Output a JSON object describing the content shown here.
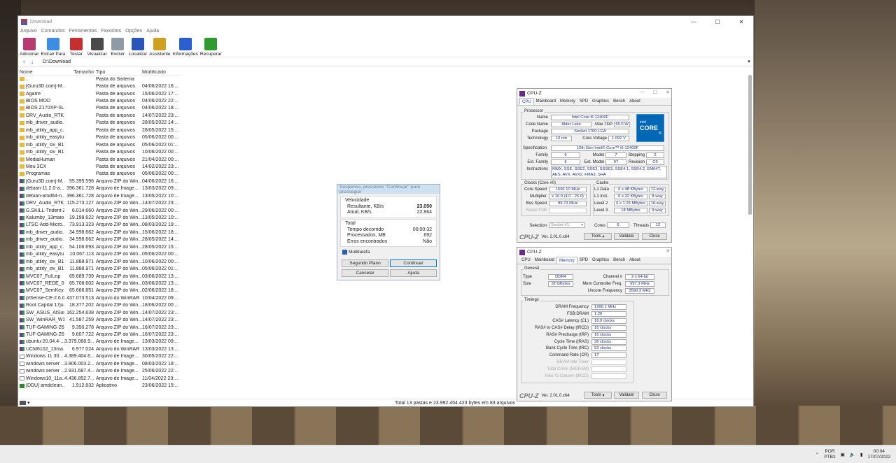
{
  "winrar": {
    "title": "Download",
    "menu": [
      "Arquivo",
      "Comandos",
      "Ferramentas",
      "Favoritos",
      "Opções",
      "Ajuda"
    ],
    "toolbar": [
      {
        "label": "Adicionar",
        "icon": "add-archive-icon",
        "color": "#b83a70"
      },
      {
        "label": "Extrair Para",
        "icon": "extract-folder-icon",
        "color": "#3d8ee0"
      },
      {
        "label": "Testar",
        "icon": "test-checklist-icon",
        "color": "#c43030"
      },
      {
        "label": "Visualizar",
        "icon": "view-book-icon",
        "color": "#4a4a4a"
      },
      {
        "label": "Excluir",
        "icon": "delete-bin-icon",
        "color": "#8e9aa6"
      },
      {
        "label": "Localizar",
        "icon": "find-magnifier-icon",
        "color": "#2a56b8"
      },
      {
        "label": "Assistente",
        "icon": "wizard-wand-icon",
        "color": "#d0a020"
      },
      {
        "label": "Informações",
        "icon": "info-icon",
        "color": "#2a5fd0"
      },
      {
        "label": "Recuperar",
        "icon": "repair-first-aid-icon",
        "color": "#2f9a2f"
      }
    ],
    "path": "D:\\Download",
    "columns": [
      "Nome",
      "Tamanho",
      "Tipo",
      "Modificado"
    ],
    "files": [
      {
        "n": "..",
        "s": "",
        "t": "Pasta do Sistema",
        "m": "",
        "k": "folder"
      },
      {
        "n": "[Guru3D.com]-M...",
        "s": "",
        "t": "Pasta de arquivos",
        "m": "04/06/2022 16:...",
        "k": "folder"
      },
      {
        "n": "Agarre",
        "s": "",
        "t": "Pasta de arquivos",
        "m": "15/06/2022 17:...",
        "k": "folder"
      },
      {
        "n": "BIOS MOD",
        "s": "",
        "t": "Pasta de arquivos",
        "m": "04/06/2022 22:...",
        "k": "folder"
      },
      {
        "n": "BIOS Z170XP-SLI",
        "s": "",
        "t": "Pasta de arquivos",
        "m": "04/06/2022 18:...",
        "k": "folder"
      },
      {
        "n": "DRV_Audio_RTK_...",
        "s": "",
        "t": "Pasta de arquivos",
        "m": "14/07/2022 23:...",
        "k": "folder"
      },
      {
        "n": "mb_driver_audio...",
        "s": "",
        "t": "Pasta de arquivos",
        "m": "28/05/2022 14:...",
        "k": "folder"
      },
      {
        "n": "mb_utility_app_c...",
        "s": "",
        "t": "Pasta de arquivos",
        "m": "28/05/2022 15:...",
        "k": "folder"
      },
      {
        "n": "mb_utility_easytu...",
        "s": "",
        "t": "Pasta de arquivos",
        "m": "05/06/2022 00:...",
        "k": "folder"
      },
      {
        "n": "mb_utility_siv_B1...",
        "s": "",
        "t": "Pasta de arquivos",
        "m": "05/06/2022 01:...",
        "k": "folder"
      },
      {
        "n": "mb_utility_siv_B1...",
        "s": "",
        "t": "Pasta de arquivos",
        "m": "10/06/2022 00:...",
        "k": "folder"
      },
      {
        "n": "MediaHuman",
        "s": "",
        "t": "Pasta de arquivos",
        "m": "21/04/2022 00:...",
        "k": "folder"
      },
      {
        "n": "Meu 3CX",
        "s": "",
        "t": "Pasta de arquivos",
        "m": "14/02/2022 23:...",
        "k": "folder"
      },
      {
        "n": "Programas",
        "s": "",
        "t": "Pasta de arquivos",
        "m": "05/06/2022 00:...",
        "k": "folder"
      },
      {
        "n": "[Guru3D.com]-M...",
        "s": "55.395.596",
        "t": "Arquivo ZIP do Win...",
        "m": "04/06/2022 16:...",
        "k": "arch"
      },
      {
        "n": "debian-11.2.0-a...",
        "s": "396.361.728",
        "t": "Arquivo de Image...",
        "m": "13/03/2022 09:...",
        "k": "arch"
      },
      {
        "n": "debian-amd64-n...",
        "s": "396.361.728",
        "t": "Arquivo de Image...",
        "m": "13/05/2022 10:...",
        "k": "arch"
      },
      {
        "n": "DRV_Audio_RTK_...",
        "s": "115.273.127",
        "t": "Arquivo ZIP do Win...",
        "m": "14/07/2022 23:...",
        "k": "arch"
      },
      {
        "n": "G.SKILL-Trident-Z...",
        "s": "6.014.660",
        "t": "Arquivo ZIP do Win...",
        "m": "29/06/2022 00:...",
        "k": "arch"
      },
      {
        "n": "Kalumby_13maio...",
        "s": "19.198.622",
        "t": "Arquivo ZIP do Win...",
        "m": "13/05/2022 10:...",
        "k": "arch"
      },
      {
        "n": "LTSC-Add-Micro...",
        "s": "73.913.323",
        "t": "Arquivo ZIP do Win...",
        "m": "08/03/2022 19:...",
        "k": "arch"
      },
      {
        "n": "mb_driver_audio...",
        "s": "34.998.662",
        "t": "Arquivo ZIP do Win...",
        "m": "15/06/2022 18:...",
        "k": "arch"
      },
      {
        "n": "mb_driver_audio...",
        "s": "34.998.662",
        "t": "Arquivo ZIP do Win...",
        "m": "28/05/2022 14:...",
        "k": "arch"
      },
      {
        "n": "mb_utility_app_c...",
        "s": "54.106.693",
        "t": "Arquivo ZIP do Win...",
        "m": "28/05/2022 15:...",
        "k": "arch"
      },
      {
        "n": "mb_utility_easytu...",
        "s": "10.067.113",
        "t": "Arquivo ZIP do Win...",
        "m": "05/06/2022 00:...",
        "k": "arch"
      },
      {
        "n": "mb_utility_siv_B1...",
        "s": "11.888.971",
        "t": "Arquivo ZIP do Win...",
        "m": "10/06/2022 00:...",
        "k": "arch"
      },
      {
        "n": "mb_utility_siv_B1...",
        "s": "11.888.971",
        "t": "Arquivo ZIP do Win...",
        "m": "05/06/2022 01:...",
        "k": "arch"
      },
      {
        "n": "MVC07_Full.zip",
        "s": "65.689.739",
        "t": "Arquivo ZIP do Win...",
        "m": "03/06/2022 13:...",
        "k": "arch"
      },
      {
        "n": "MVC07_REDE_03...",
        "s": "65.708.602",
        "t": "Arquivo ZIP do Win...",
        "m": "03/06/2022 13:...",
        "k": "arch"
      },
      {
        "n": "MVC07_SemKey...",
        "s": "65.666.851",
        "t": "Arquivo ZIP do Win...",
        "m": "02/06/2022 18:...",
        "k": "arch"
      },
      {
        "n": "pfSense-CE-2.6.0...",
        "s": "437.073.513",
        "t": "Arquivo do WinRAR",
        "m": "10/04/2022 09:...",
        "k": "arch"
      },
      {
        "n": "Root Capital 17ju...",
        "s": "18.377.202",
        "t": "Arquivo ZIP do Win...",
        "m": "18/06/2022 00:...",
        "k": "arch"
      },
      {
        "n": "SW_ASUS_AISuit...",
        "s": "162.254.638",
        "t": "Arquivo ZIP do Win...",
        "m": "14/07/2022 23:...",
        "k": "arch"
      },
      {
        "n": "SW_WinRAR_W1...",
        "s": "41.587.259",
        "t": "Arquivo ZIP do Win...",
        "m": "14/07/2022 23:...",
        "k": "arch"
      },
      {
        "n": "TUF-GAMING-Z6...",
        "s": "9.350.278",
        "t": "Arquivo ZIP do Win...",
        "m": "16/07/2022 23:...",
        "k": "arch"
      },
      {
        "n": "TUF-GAMING-Z6...",
        "s": "9.607.722",
        "t": "Arquivo ZIP do Win...",
        "m": "16/07/2022 23:...",
        "k": "arch"
      },
      {
        "n": "ubuntu-20.04.4-...",
        "s": "3.379.068.9...",
        "t": "Arquivo de Image...",
        "m": "13/03/2022 09:...",
        "k": "arch"
      },
      {
        "n": "UCM6102_13ma...",
        "s": "6.977.024",
        "t": "Arquivo do WinRAR",
        "m": "13/03/2022 13:...",
        "k": "arch"
      },
      {
        "n": "Windows 11 30...",
        "s": "4.389.404.6...",
        "t": "Arquivo de Image...",
        "m": "30/05/2022 22:...",
        "k": "doc"
      },
      {
        "n": "windows server ...",
        "s": "3.806.003.2...",
        "t": "Arquivo de Image...",
        "m": "08/03/2022 18:...",
        "k": "doc"
      },
      {
        "n": "windows server ...",
        "s": "2.931.687.4...",
        "t": "Arquivo de Image...",
        "m": "25/06/2022 22:...",
        "k": "doc"
      },
      {
        "n": "Windows10_11a...",
        "s": "4.436.852.7...",
        "t": "Arquivo de Image...",
        "m": "11/04/2022 23:...",
        "k": "doc"
      },
      {
        "n": "[DDU] amdclean...",
        "s": "1.912.832",
        "t": "Aplicativo",
        "m": "23/06/2022 15:...",
        "k": "app"
      }
    ],
    "status": "Total 13 pastas e 23.992.454.423 bytes em 83 arquivos"
  },
  "dialog": {
    "title": "Suspenso, pressione \"Continuar\" para prosseguir",
    "speed_heading": "Velocidade",
    "speed": [
      {
        "k": "Resultante, KB/s",
        "v": "23.050",
        "bold": true
      },
      {
        "k": "Atual, KB/s",
        "v": "22.864",
        "bold": false
      }
    ],
    "total_heading": "Total",
    "totals": [
      {
        "k": "Tempo decorrido",
        "v": "00:00:32"
      },
      {
        "k": "Processados, MB",
        "v": "692"
      },
      {
        "k": "Erros encontrados",
        "v": "Não"
      }
    ],
    "multitask": "Multitarefa",
    "buttons": {
      "background": "Segundo Plano",
      "continue": "Continuar",
      "cancel": "Cancelar",
      "help": "Ajuda"
    }
  },
  "cpuz1": {
    "title": "CPU-Z",
    "tabs": [
      "CPU",
      "Mainboard",
      "Memory",
      "SPD",
      "Graphics",
      "Bench",
      "About"
    ],
    "active": "CPU",
    "processor_label": "Processor",
    "fields": {
      "name_l": "Name",
      "name": "Intel Core i5 12400F",
      "code_l": "Code Name",
      "code": "Alder Lake",
      "tdp_l": "Max TDP",
      "tdp": "65.0 W",
      "pkg_l": "Package",
      "pkg": "Socket 1700 LGA",
      "tech_l": "Technology",
      "tech": "10 nm",
      "cv_l": "Core Voltage",
      "cv": "1.092 V",
      "spec_l": "Specification",
      "spec": "12th Gen Intel® Core™ i5-12400F",
      "fam_l": "Family",
      "fam": "6",
      "mod_l": "Model",
      "mod": "7",
      "step_l": "Stepping",
      "step": "2",
      "efam_l": "Ext. Family",
      "efam": "6",
      "emod_l": "Ext. Model",
      "emod": "97",
      "rev_l": "Revision",
      "rev": "C0",
      "inst_l": "Instructions",
      "inst": "MMX, SSE, SSE2, SSE3, SSSE3, SSE4.1, SSE4.2, EM64T, AES, AVX, AVX2, FMA3, SHA"
    },
    "intel_badge": {
      "brand": "intel",
      "line": "CORE",
      "tier": "i5"
    },
    "clocks_label": "Clocks (Core #0)",
    "clocks": {
      "cs_l": "Core Speed",
      "cs": "1596.10 MHz",
      "mul_l": "Multiplier",
      "mul": "x 16.0 (4.0 - 25.0)",
      "bus_l": "Bus Speed",
      "bus": "99.73 MHz",
      "fsb_l": "Rated FSB",
      "fsb": ""
    },
    "cache_label": "Cache",
    "cache": [
      {
        "l": "L1 Data",
        "v": "6 x 48 KBytes",
        "w": "12-way"
      },
      {
        "l": "L1 Inst.",
        "v": "6 x 32 KBytes",
        "w": "8-way"
      },
      {
        "l": "Level 2",
        "v": "6 x 1.25 MBytes",
        "w": "10-way"
      },
      {
        "l": "Level 3",
        "v": "18 MBytes",
        "w": "9-way"
      }
    ],
    "sel": {
      "l": "Selection",
      "v": "Socket #1",
      "cores_l": "Cores",
      "cores": "6",
      "threads_l": "Threads",
      "threads": "12"
    },
    "footer": {
      "brand": "CPU-Z",
      "version": "Ver. 2.01.0.x64",
      "tools": "Tools",
      "validate": "Validate",
      "close": "Close"
    }
  },
  "cpuz2": {
    "title": "CPU-Z",
    "tabs": [
      "CPU",
      "Mainboard",
      "Memory",
      "SPD",
      "Graphics",
      "Bench",
      "About"
    ],
    "active": "Memory",
    "general_label": "General",
    "general": {
      "type_l": "Type",
      "type": "DDR4",
      "ch_l": "Channel #",
      "ch": "2 x 64-bit",
      "size_l": "Size",
      "size": "32 GBytes",
      "mcf_l": "Mem Controller Freq.",
      "mcf": "997.3 MHz",
      "unc_l": "Uncore Frequency",
      "unc": "3590.3 MHz"
    },
    "timings_label": "Timings",
    "timings": [
      {
        "l": "DRAM Frequency",
        "v": "1995.1 MHz",
        "dim": false
      },
      {
        "l": "FSB:DRAM",
        "v": "1:20",
        "dim": false
      },
      {
        "l": "CAS# Latency (CL)",
        "v": "16.0 clocks",
        "dim": false
      },
      {
        "l": "RAS# to CAS# Delay (tRCD)",
        "v": "16 clocks",
        "dim": false
      },
      {
        "l": "RAS# Precharge (tRP)",
        "v": "16 clocks",
        "dim": false
      },
      {
        "l": "Cycle Time (tRAS)",
        "v": "36 clocks",
        "dim": false
      },
      {
        "l": "Bank Cycle Time (tRC)",
        "v": "52 clocks",
        "dim": false
      },
      {
        "l": "Command Rate (CR)",
        "v": "1T",
        "dim": false
      },
      {
        "l": "DRAM Idle Timer",
        "v": "",
        "dim": true
      },
      {
        "l": "Total CAS# (tRDRAM)",
        "v": "",
        "dim": true
      },
      {
        "l": "Row To Column (tRCD)",
        "v": "",
        "dim": true
      }
    ],
    "footer": {
      "brand": "CPU-Z",
      "version": "Ver. 2.01.0.x64",
      "tools": "Tools",
      "validate": "Validate",
      "close": "Close"
    }
  },
  "taskbar": {
    "lang1": "POR",
    "lang2": "PTB2",
    "time": "00:04",
    "date": "17/07/2022"
  }
}
